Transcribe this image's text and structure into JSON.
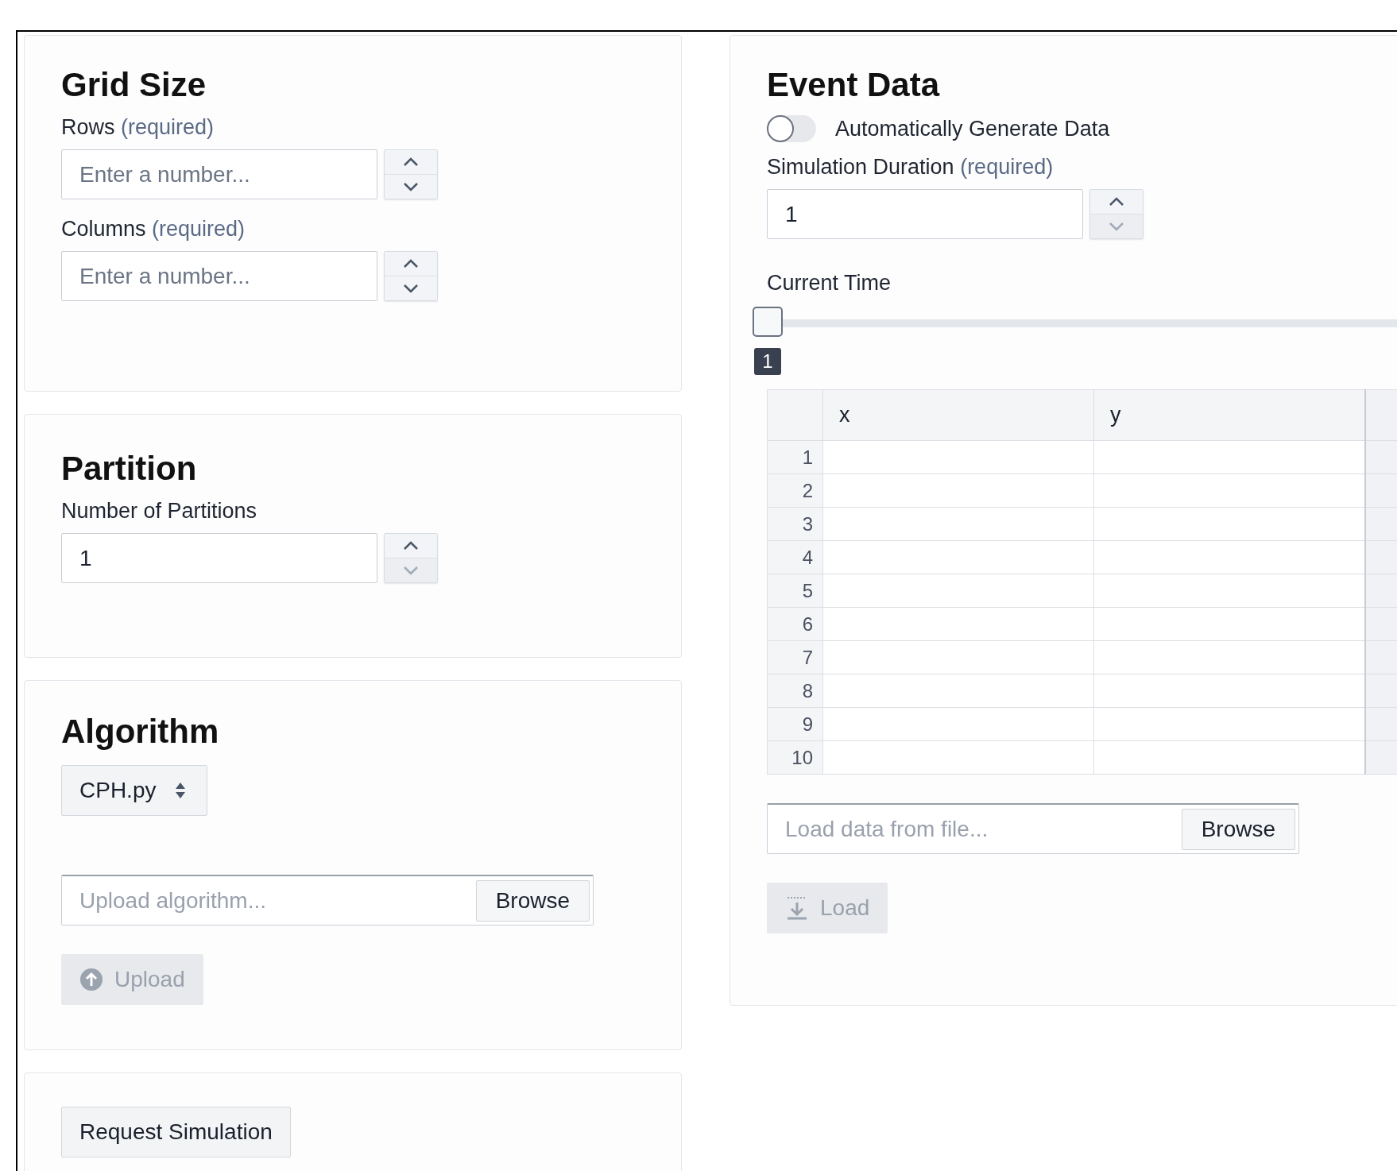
{
  "grid_size": {
    "title": "Grid Size",
    "fields": [
      {
        "label": "Rows",
        "hint": "(required)",
        "placeholder": "Enter a number...",
        "down_disabled": false
      },
      {
        "label": "Columns",
        "hint": "(required)",
        "placeholder": "Enter a number...",
        "down_disabled": false
      }
    ]
  },
  "partition": {
    "title": "Partition",
    "fields": [
      {
        "label": "Number of Partitions",
        "value": "1",
        "down_disabled": true
      }
    ]
  },
  "algorithm": {
    "title": "Algorithm",
    "select": {
      "value": "CPH.py"
    },
    "upload_field": {
      "placeholder": "Upload algorithm...",
      "browse": "Browse"
    },
    "upload_button": {
      "label": "Upload",
      "disabled": true
    }
  },
  "request_button": {
    "label": "Request Simulation"
  },
  "event_data": {
    "title": "Event Data",
    "toggle": {
      "label": "Automatically Generate Data",
      "on": false
    },
    "duration": {
      "label": "Simulation Duration",
      "hint": "(required)",
      "value": "1",
      "down_disabled": true
    },
    "current_time": {
      "label": "Current Time",
      "level": 0,
      "badge": "1"
    },
    "table": {
      "columns": [
        "x",
        "y"
      ],
      "rows": [
        "1",
        "2",
        "3",
        "4",
        "5",
        "6",
        "7",
        "8",
        "9",
        "10"
      ]
    },
    "file_field": {
      "placeholder": "Load data from file...",
      "browse": "Browse"
    },
    "load_button": {
      "label": "Load",
      "disabled": true
    }
  }
}
